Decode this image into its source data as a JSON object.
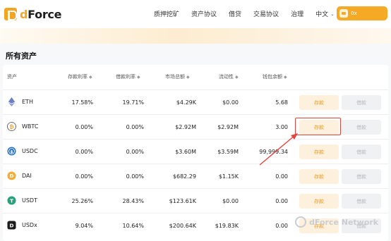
{
  "brand": {
    "logo_d": "d",
    "logo_rest": "Force"
  },
  "nav": {
    "items": [
      "质押挖矿",
      "资产协议",
      "借贷",
      "交易协议",
      "治理"
    ],
    "lang": "中文"
  },
  "wallet": {
    "address": "0x"
  },
  "section_title": "所有资产",
  "table": {
    "headers": [
      "资产",
      "存款利率",
      "借款利率",
      "市场总额",
      "流动性",
      "钱包余额"
    ],
    "sort_marker": "◆",
    "deposit_label": "存款",
    "borrow_label": "借款",
    "rows": [
      {
        "asset": "ETH",
        "icon": "eth-icon",
        "deposit_rate": "17.58%",
        "borrow_rate": "19.71%",
        "market": "$4.29K",
        "liquidity": "$0.00",
        "balance": "5.68"
      },
      {
        "asset": "WBTC",
        "icon": "wbtc-icon",
        "deposit_rate": "0.00%",
        "borrow_rate": "0.00%",
        "market": "$2.92M",
        "liquidity": "$2.92M",
        "balance": "3.00"
      },
      {
        "asset": "USDC",
        "icon": "usdc-icon",
        "deposit_rate": "0.00%",
        "borrow_rate": "0.00%",
        "market": "$3.60M",
        "liquidity": "$3.59M",
        "balance": "99,999.34"
      },
      {
        "asset": "DAI",
        "icon": "dai-icon",
        "deposit_rate": "0.00%",
        "borrow_rate": "0.00%",
        "market": "$682.29",
        "liquidity": "$1.15K",
        "balance": "0.00"
      },
      {
        "asset": "USDT",
        "icon": "usdt-icon",
        "deposit_rate": "25.26%",
        "borrow_rate": "28.43%",
        "market": "$123.61K",
        "liquidity": "$0.00",
        "balance": "0.00"
      },
      {
        "asset": "USDx",
        "icon": "usdx-icon",
        "deposit_rate": "9.04%",
        "borrow_rate": "10.64%",
        "market": "$200.64K",
        "liquidity": "$19.83K",
        "balance": "0.00"
      }
    ]
  },
  "watermark": "dForce Network",
  "colors": {
    "brand": "#f4a425",
    "deposit_bg": "#fdf0dc",
    "deposit_text": "#e59d2b",
    "annotation": "#e4443c"
  }
}
